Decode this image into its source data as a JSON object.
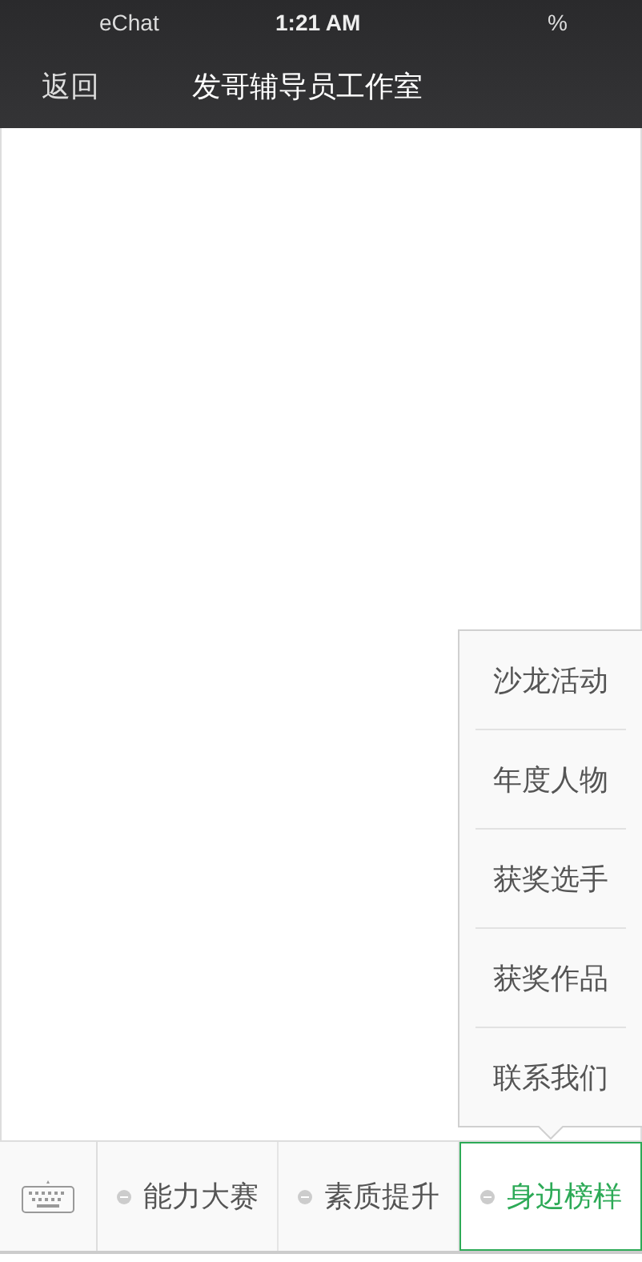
{
  "status_bar": {
    "carrier": "eChat",
    "time": "1:21 AM",
    "battery": "%"
  },
  "nav": {
    "back": "返回",
    "title": "发哥辅导员工作室"
  },
  "submenu": {
    "items": [
      "沙龙活动",
      "年度人物",
      "获奖选手",
      "获奖作品",
      "联系我们"
    ]
  },
  "menu": [
    {
      "label": "能力大赛",
      "selected": false
    },
    {
      "label": "素质提升",
      "selected": false
    },
    {
      "label": "身边榜样",
      "selected": true
    }
  ]
}
